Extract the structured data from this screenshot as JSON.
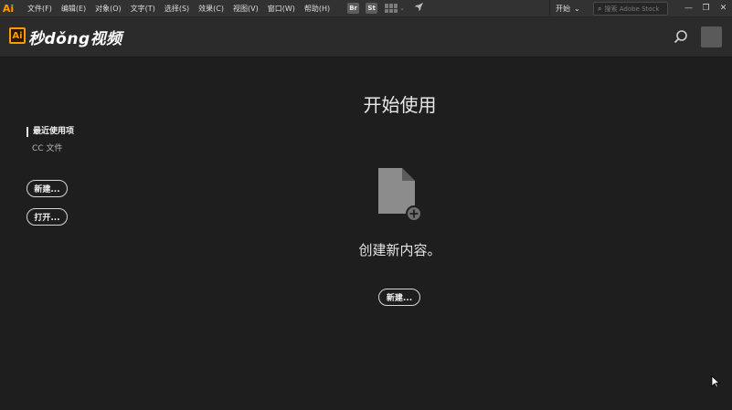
{
  "app": {
    "logo_small": "Ai",
    "menu": [
      "文件(F)",
      "编辑(E)",
      "对象(O)",
      "文字(T)",
      "选择(S)",
      "效果(C)",
      "视图(V)",
      "窗口(W)",
      "帮助(H)"
    ],
    "bridge_label": "Br",
    "stock_label": "St",
    "workspace": "开始",
    "search_placeholder": "搜索 Adobe Stock",
    "window_controls": [
      "—",
      "❐",
      "✕"
    ]
  },
  "header": {
    "brand_ai": "Ai",
    "brand_text": "秒dǒng视频"
  },
  "sidebar": {
    "recent": "最近使用项",
    "cc_files": "CC 文件",
    "new_button": "新建...",
    "open_button": "打开..."
  },
  "main": {
    "title": "开始使用",
    "create_text": "创建新内容。",
    "new_button": "新建..."
  },
  "colors": {
    "accent": "#ff9a00",
    "background": "#1e1e1e",
    "header": "#2b2b2b",
    "menubar": "#323232"
  },
  "icons": [
    "search-icon",
    "bridge-icon",
    "stock-icon",
    "arrange-documents-icon",
    "rocket-icon",
    "new-document-icon",
    "user-avatar",
    "mouse-cursor-icon"
  ]
}
